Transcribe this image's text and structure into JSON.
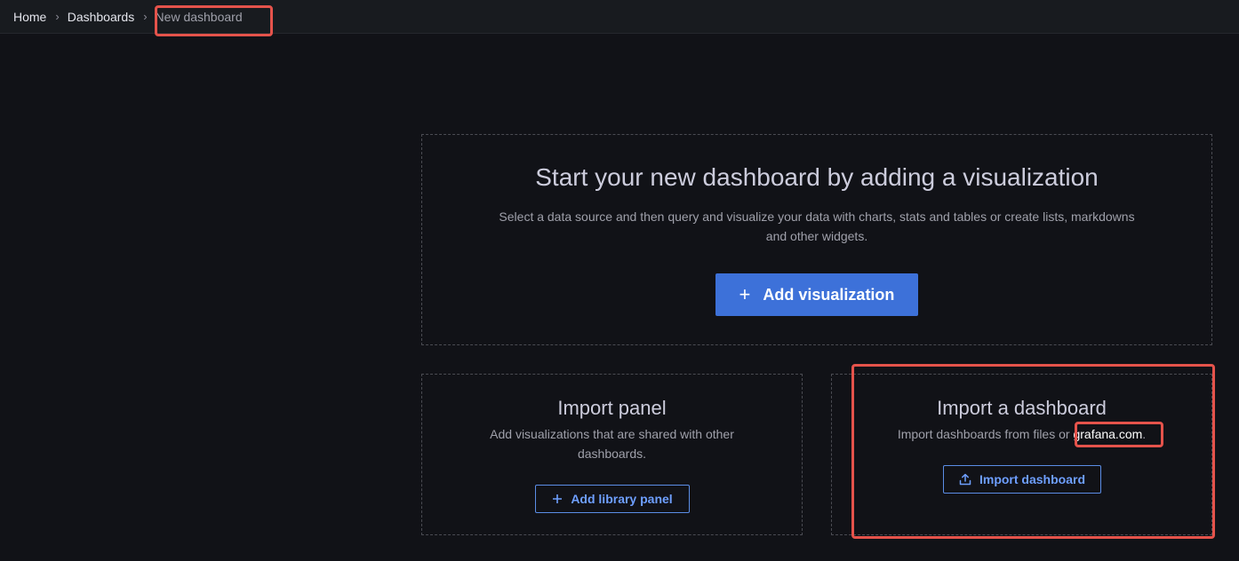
{
  "breadcrumb": {
    "home": "Home",
    "dashboards": "Dashboards",
    "current": "New dashboard",
    "separator": "›"
  },
  "main": {
    "title": "Start your new dashboard by adding a visualization",
    "description": "Select a data source and then query and visualize your data with charts, stats and tables or create lists, markdowns and other widgets.",
    "button_label": "Add visualization",
    "button_icon": "plus-icon"
  },
  "import_panel": {
    "title": "Import panel",
    "description": "Add visualizations that are shared with other dashboards.",
    "button_label": "Add library panel",
    "button_icon": "plus-icon"
  },
  "import_dashboard": {
    "title": "Import a dashboard",
    "description_prefix": "Import dashboards from files or ",
    "link_text": "grafana.com",
    "description_suffix": ".",
    "button_label": "Import dashboard",
    "button_icon": "upload-icon"
  },
  "colors": {
    "background": "#111217",
    "primary": "#3d71d9",
    "highlight": "#e5534b"
  }
}
